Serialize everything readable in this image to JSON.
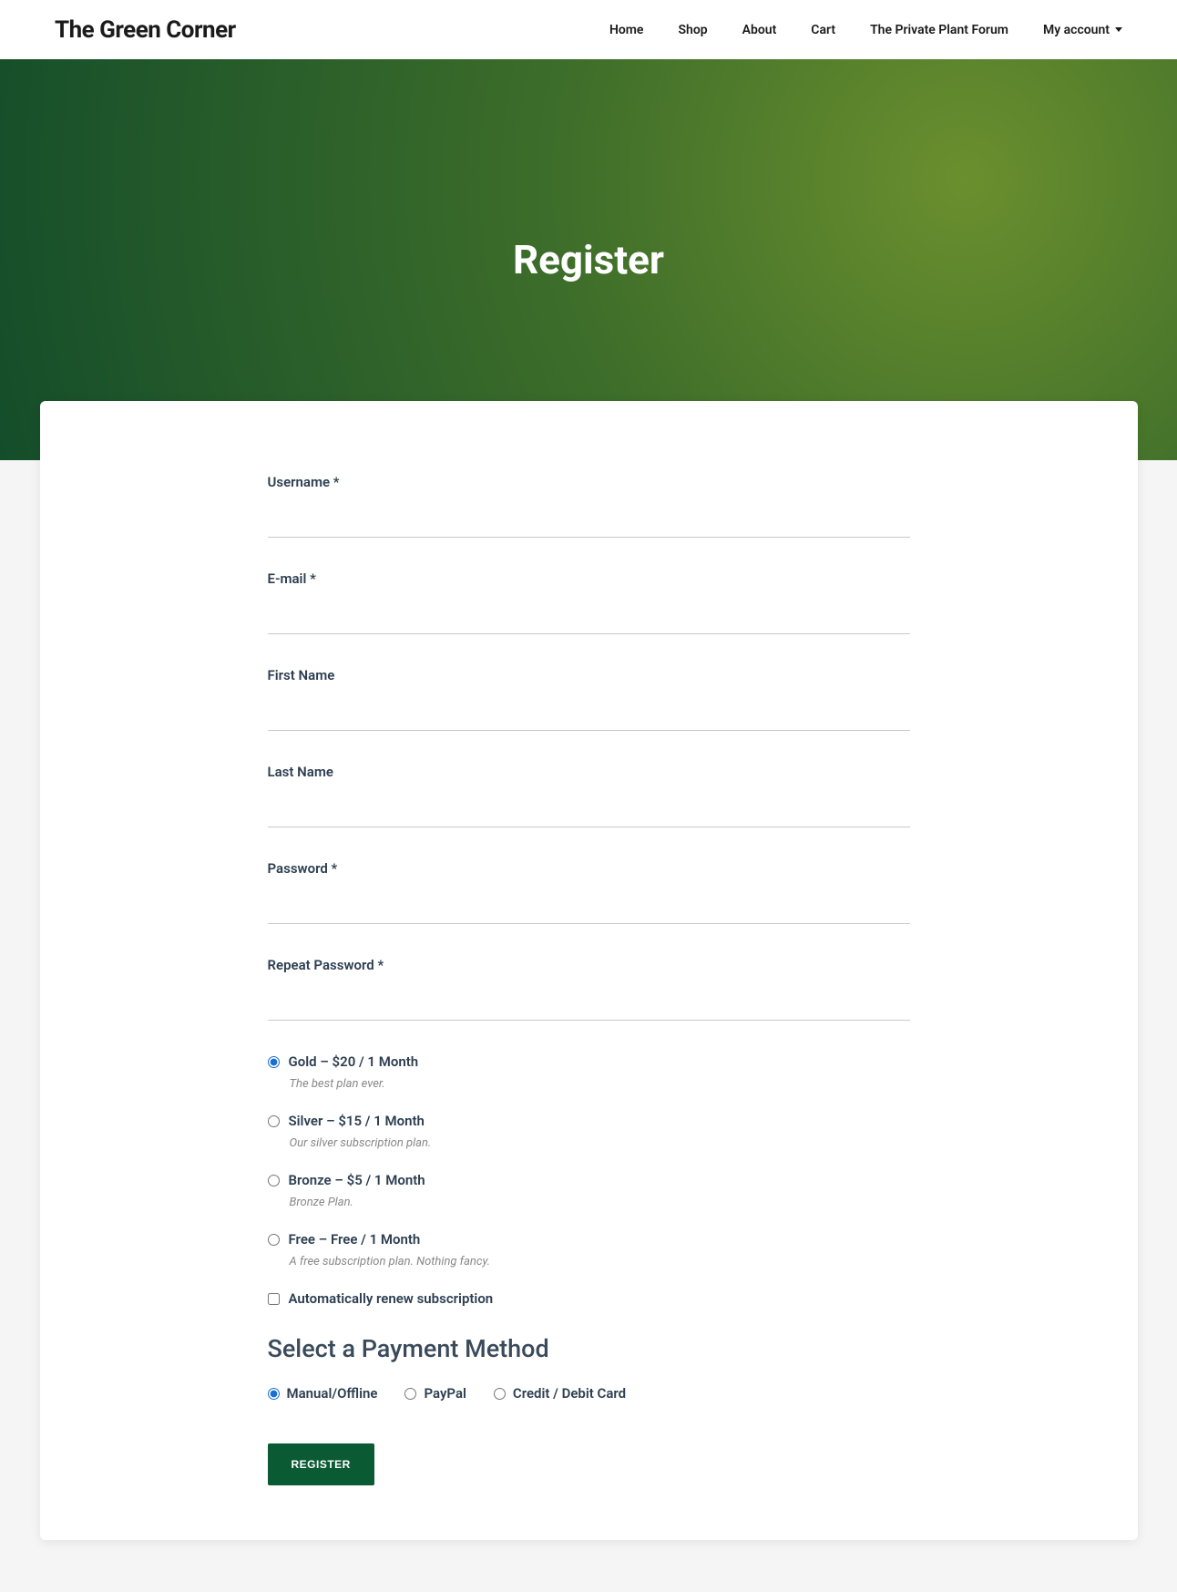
{
  "brand": "The Green Corner",
  "nav": {
    "home": "Home",
    "shop": "Shop",
    "about": "About",
    "cart": "Cart",
    "forum": "The Private Plant Forum",
    "account": "My account"
  },
  "hero": {
    "title": "Register"
  },
  "form": {
    "username": "Username *",
    "email": "E-mail *",
    "firstname": "First Name",
    "lastname": "Last Name",
    "password": "Password *",
    "repeat": "Repeat Password *"
  },
  "plans": [
    {
      "label": "Gold – $20 / 1 Month",
      "desc": "The best plan ever.",
      "checked": true
    },
    {
      "label": "Silver – $15 / 1 Month",
      "desc": "Our silver subscription plan.",
      "checked": false
    },
    {
      "label": "Bronze – $5 / 1 Month",
      "desc": "Bronze Plan.",
      "checked": false
    },
    {
      "label": "Free – Free / 1 Month",
      "desc": "A free subscription plan. Nothing fancy.",
      "checked": false
    }
  ],
  "renew_label": "Automatically renew subscription",
  "payment_heading": "Select a Payment Method",
  "payments": [
    {
      "label": "Manual/Offline",
      "checked": true
    },
    {
      "label": "PayPal",
      "checked": false
    },
    {
      "label": "Credit / Debit Card",
      "checked": false
    }
  ],
  "submit": "REGISTER"
}
